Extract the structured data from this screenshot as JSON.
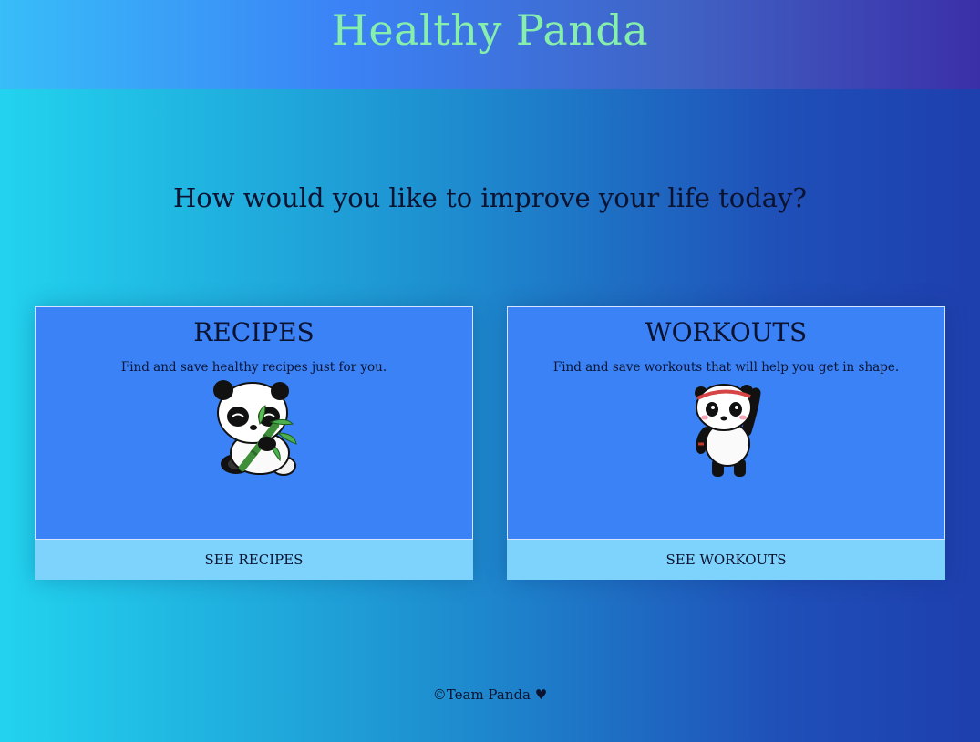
{
  "header": {
    "title": "Healthy Panda"
  },
  "main": {
    "question": "How would you like to improve your life today?",
    "cards": [
      {
        "title": "RECIPES",
        "description": "Find and save healthy recipes just for you.",
        "button_label": "SEE RECIPES",
        "icon": "panda-eating-bamboo-icon"
      },
      {
        "title": "WORKOUTS",
        "description": "Find and save workouts that will help you get in shape.",
        "button_label": "SEE WORKOUTS",
        "icon": "panda-exercising-icon"
      }
    ]
  },
  "footer": {
    "text": "©Team Panda ♥"
  },
  "colors": {
    "title": "#86efac",
    "card_background": "#3b82f6",
    "button_background": "#7dd3fc",
    "text": "#0b1330"
  }
}
